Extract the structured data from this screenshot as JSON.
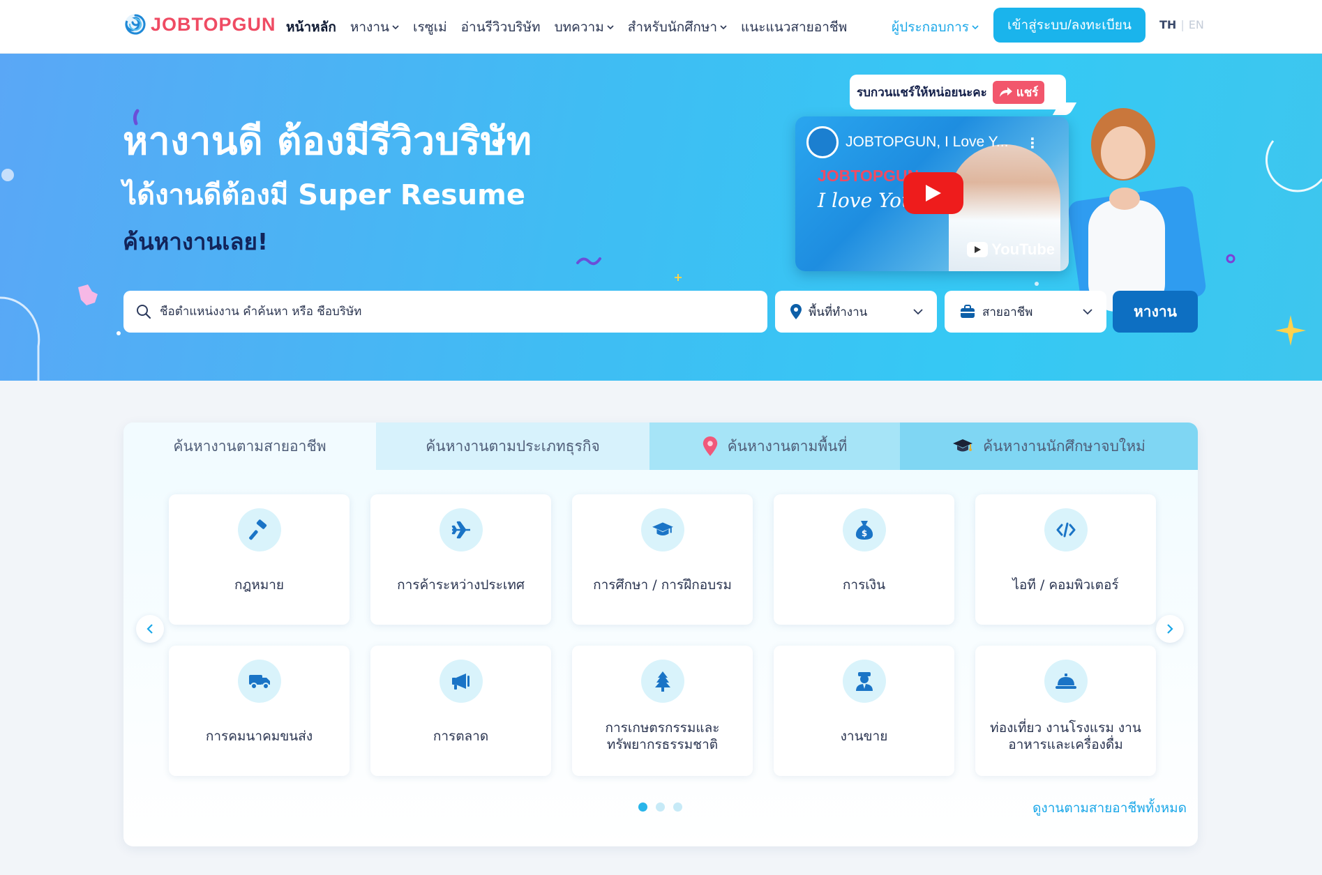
{
  "header": {
    "logo_text": "JOBTOPGUN",
    "nav": [
      {
        "label": "หน้าหลัก",
        "active": true,
        "dropdown": false
      },
      {
        "label": "หางาน",
        "active": false,
        "dropdown": true
      },
      {
        "label": "เรซูเม่",
        "active": false,
        "dropdown": false
      },
      {
        "label": "อ่านรีวิวบริษัท",
        "active": false,
        "dropdown": false
      },
      {
        "label": "บทความ",
        "active": false,
        "dropdown": true
      },
      {
        "label": "สำหรับนักศึกษา",
        "active": false,
        "dropdown": true
      },
      {
        "label": "แนะแนวสายอาชีพ",
        "active": false,
        "dropdown": false
      }
    ],
    "employer_label": "ผู้ประกอบการ",
    "login_label": "เข้าสู่ระบบ/ลงทะเบียน",
    "lang_th": "TH",
    "lang_en": "EN"
  },
  "hero": {
    "title": "หางานดี ต้องมีรีวิวบริษัท",
    "subtitle": "ได้งานดีต้องมี Super Resume",
    "cta": "ค้นหางานเลย!",
    "share_text": "รบกวนแชร์ให้หน่อยนะคะ",
    "share_button": "แชร์",
    "video": {
      "title": "JOBTOPGUN, I Love Y...",
      "brand": "JOBTOPGUN",
      "script_text": "I love You",
      "platform": "YouTube"
    }
  },
  "search": {
    "placeholder": "ชื่อตำแหน่งงาน คำค้นหา หรือ ชื่อบริษัท",
    "value": "",
    "area_label": "พื้นที่ทำงาน",
    "career_label": "สายอาชีพ",
    "submit_label": "หางาน"
  },
  "categories": {
    "tabs": [
      {
        "label": "ค้นหางานตามสายอาชีพ",
        "icon": ""
      },
      {
        "label": "ค้นหางานตามประเภทธุรกิจ",
        "icon": ""
      },
      {
        "label": "ค้นหางานตามพื้นที่",
        "icon": "location-pin-icon"
      },
      {
        "label": "ค้นหางานนักศึกษาจบใหม่",
        "icon": "graduation-cap-icon"
      }
    ],
    "items": [
      {
        "label": "กฎหมาย",
        "icon": "gavel-icon"
      },
      {
        "label": "การค้าระหว่างประเทศ",
        "icon": "airplane-icon"
      },
      {
        "label": "การศึกษา / การฝึกอบรม",
        "icon": "graduation-cap-icon"
      },
      {
        "label": "การเงิน",
        "icon": "money-bag-icon"
      },
      {
        "label": "ไอที / คอมพิวเตอร์",
        "icon": "code-icon"
      },
      {
        "label": "การคมนาคมขนส่ง",
        "icon": "truck-icon"
      },
      {
        "label": "การตลาด",
        "icon": "megaphone-icon"
      },
      {
        "label": "การเกษตรกรรมและ ทรัพยากรธรรมชาติ",
        "icon": "tree-icon"
      },
      {
        "label": "งานขาย",
        "icon": "salesperson-icon"
      },
      {
        "label": "ท่องเที่ยว งานโรงแรม งาน อาหารและเครื่องดื่ม",
        "icon": "service-bell-icon"
      }
    ],
    "page_count": 3,
    "active_page": 1,
    "see_all_label": "ดูงานตามสายอาชีพทั้งหมด"
  },
  "colors": {
    "brand_red": "#ef4b63",
    "accent_blue": "#1ab4ec",
    "button_dark_blue": "#0d6fc2",
    "hero_start": "#5aa7f6",
    "hero_end": "#3ec6ee",
    "icon_blue": "#1a74c6"
  }
}
